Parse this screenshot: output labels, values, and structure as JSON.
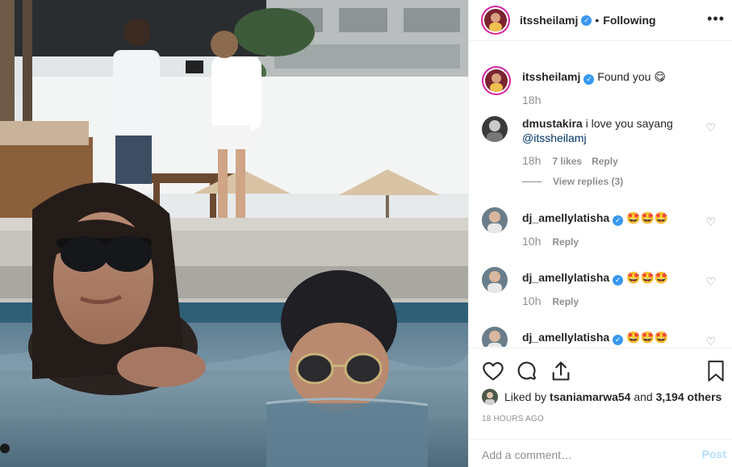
{
  "post": {
    "author": "itssheilamj",
    "follow_separator": "•",
    "follow_state": "Following",
    "more_icon": "more-horizontal-icon"
  },
  "caption": {
    "username": "itssheilamj",
    "text": "Found you 😋",
    "time": "18h"
  },
  "comments": [
    {
      "username": "dmustakira",
      "text": "i love you sayang",
      "mention": "@itssheilamj",
      "time": "18h",
      "likes": "7 likes",
      "reply": "Reply",
      "view_replies": "View replies (3)"
    },
    {
      "username": "dj_amellylatisha",
      "text": "🤩🤩🤩",
      "time": "10h",
      "reply": "Reply"
    },
    {
      "username": "dj_amellylatisha",
      "text": "🤩🤩🤩",
      "time": "10h",
      "reply": "Reply"
    },
    {
      "username": "dj_amellylatisha",
      "text": "🤩🤩🤩"
    }
  ],
  "likes": {
    "prefix": "Liked by",
    "user": "tsaniamarwa54",
    "conjunction": "and",
    "others": "3,194 others"
  },
  "timestamp": "18 hours ago",
  "add_comment": {
    "placeholder": "Add a comment…",
    "post_label": "Post"
  },
  "colors": {
    "verified": "#3897f0",
    "post_disabled": "#b2dffc",
    "story_ring": "#d6249f"
  }
}
